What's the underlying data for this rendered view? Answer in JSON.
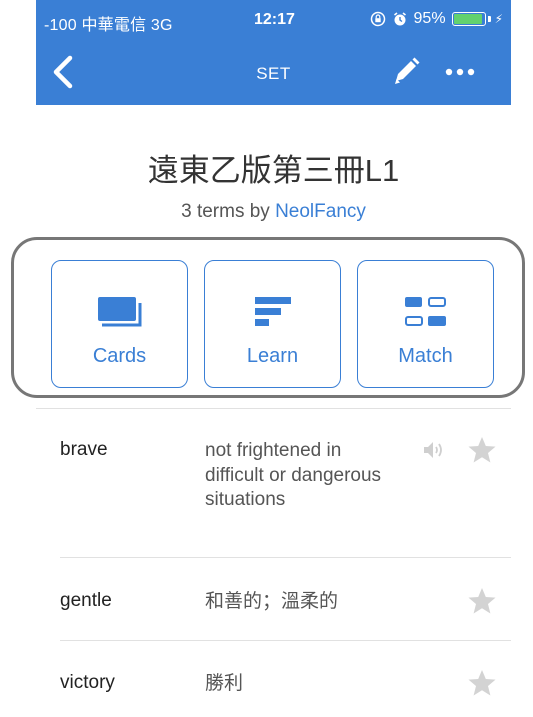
{
  "status_bar": {
    "carrier": "-100 中華電信  3G",
    "time": "12:17",
    "battery_percent": "95%",
    "battery_level": 0.95
  },
  "nav": {
    "title": "SET",
    "back_icon": "chevron-left-icon",
    "edit_icon": "pencil-icon",
    "more_icon": "more-dots-icon"
  },
  "set": {
    "title": "遠東乙版第三冊L1",
    "meta_prefix": "3 terms by ",
    "author": "NeolFancy"
  },
  "modes": [
    {
      "label": "Cards",
      "icon": "cards-icon"
    },
    {
      "label": "Learn",
      "icon": "learn-icon"
    },
    {
      "label": "Match",
      "icon": "match-icon"
    }
  ],
  "terms": [
    {
      "term": "brave",
      "definition": "not frightened in difficult or dangerous situations",
      "has_audio": true,
      "starred": false
    },
    {
      "term": "gentle",
      "definition": "和善的；溫柔的",
      "has_audio": false,
      "starred": false
    },
    {
      "term": "victory",
      "definition": "勝利",
      "has_audio": false,
      "starred": false
    }
  ],
  "colors": {
    "brand": "#3a7fd5",
    "highlight_border": "#777777",
    "star": "#d3d3d3",
    "battery": "#62d26f"
  }
}
